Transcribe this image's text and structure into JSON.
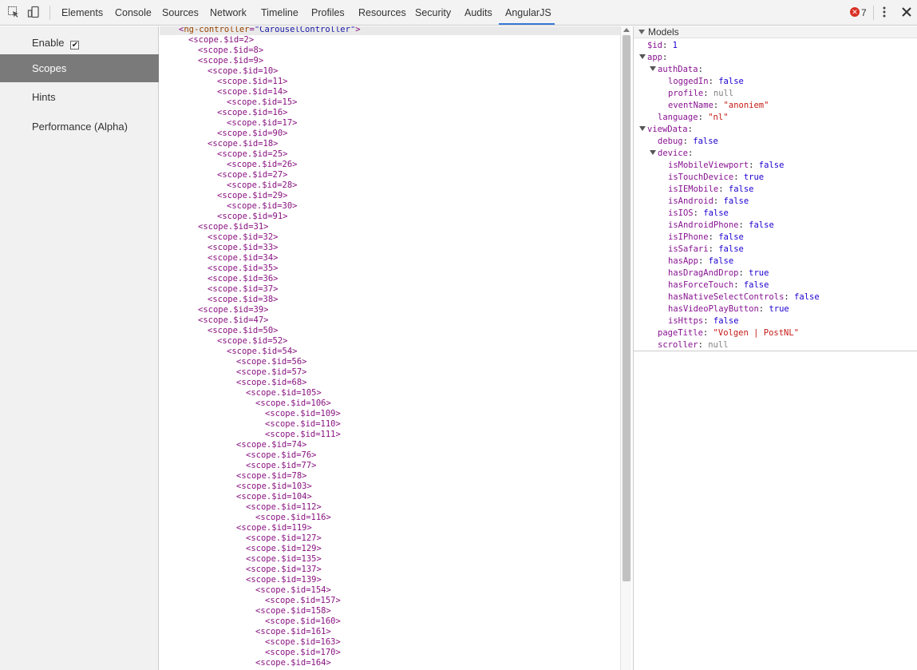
{
  "toolbar": {
    "tabs": [
      "Elements",
      "Console",
      "Sources",
      "Network",
      "Timeline",
      "Profiles",
      "Resources",
      "Security",
      "Audits",
      "AngularJS"
    ],
    "active_tab": "AngularJS",
    "error_count": "7",
    "accent": "#3879d9"
  },
  "sidebar": {
    "enable_label": "Enable",
    "enable_checked": "✔",
    "items": [
      "Scopes",
      "Hints",
      "Performance (Alpha)"
    ],
    "selected": "Scopes"
  },
  "tree": {
    "root_tag_open": "<",
    "root_attr_name": "ng-controller",
    "root_attr_eq": "=",
    "root_attr_value": "\"CarouselController\"",
    "root_tag_close": ">",
    "rows": [
      {
        "level": 1,
        "text": "<scope.$id=2>"
      },
      {
        "level": 2,
        "text": "<scope.$id=8>"
      },
      {
        "level": 2,
        "text": "<scope.$id=9>"
      },
      {
        "level": 3,
        "text": "<scope.$id=10>"
      },
      {
        "level": 4,
        "text": "<scope.$id=11>"
      },
      {
        "level": 4,
        "text": "<scope.$id=14>"
      },
      {
        "level": 5,
        "text": "<scope.$id=15>"
      },
      {
        "level": 4,
        "text": "<scope.$id=16>"
      },
      {
        "level": 5,
        "text": "<scope.$id=17>"
      },
      {
        "level": 4,
        "text": "<scope.$id=90>"
      },
      {
        "level": 3,
        "text": "<scope.$id=18>"
      },
      {
        "level": 4,
        "text": "<scope.$id=25>"
      },
      {
        "level": 5,
        "text": "<scope.$id=26>"
      },
      {
        "level": 4,
        "text": "<scope.$id=27>"
      },
      {
        "level": 5,
        "text": "<scope.$id=28>"
      },
      {
        "level": 4,
        "text": "<scope.$id=29>"
      },
      {
        "level": 5,
        "text": "<scope.$id=30>"
      },
      {
        "level": 4,
        "text": "<scope.$id=91>"
      },
      {
        "level": 2,
        "text": "<scope.$id=31>"
      },
      {
        "level": 3,
        "text": "<scope.$id=32>"
      },
      {
        "level": 3,
        "text": "<scope.$id=33>"
      },
      {
        "level": 3,
        "text": "<scope.$id=34>"
      },
      {
        "level": 3,
        "text": "<scope.$id=35>"
      },
      {
        "level": 3,
        "text": "<scope.$id=36>"
      },
      {
        "level": 3,
        "text": "<scope.$id=37>"
      },
      {
        "level": 3,
        "text": "<scope.$id=38>"
      },
      {
        "level": 2,
        "text": "<scope.$id=39>"
      },
      {
        "level": 2,
        "text": "<scope.$id=47>"
      },
      {
        "level": 3,
        "text": "<scope.$id=50>"
      },
      {
        "level": 4,
        "text": "<scope.$id=52>"
      },
      {
        "level": 5,
        "text": "<scope.$id=54>"
      },
      {
        "level": 6,
        "text": "<scope.$id=56>"
      },
      {
        "level": 6,
        "text": "<scope.$id=57>"
      },
      {
        "level": 6,
        "text": "<scope.$id=68>"
      },
      {
        "level": 7,
        "text": "<scope.$id=105>"
      },
      {
        "level": 8,
        "text": "<scope.$id=106>"
      },
      {
        "level": 9,
        "text": "<scope.$id=109>"
      },
      {
        "level": 9,
        "text": "<scope.$id=110>"
      },
      {
        "level": 9,
        "text": "<scope.$id=111>"
      },
      {
        "level": 6,
        "text": "<scope.$id=74>"
      },
      {
        "level": 7,
        "text": "<scope.$id=76>"
      },
      {
        "level": 7,
        "text": "<scope.$id=77>"
      },
      {
        "level": 6,
        "text": "<scope.$id=78>"
      },
      {
        "level": 6,
        "text": "<scope.$id=103>"
      },
      {
        "level": 6,
        "text": "<scope.$id=104>"
      },
      {
        "level": 7,
        "text": "<scope.$id=112>"
      },
      {
        "level": 8,
        "text": "<scope.$id=116>"
      },
      {
        "level": 6,
        "text": "<scope.$id=119>"
      },
      {
        "level": 7,
        "text": "<scope.$id=127>"
      },
      {
        "level": 7,
        "text": "<scope.$id=129>"
      },
      {
        "level": 7,
        "text": "<scope.$id=135>"
      },
      {
        "level": 7,
        "text": "<scope.$id=137>"
      },
      {
        "level": 7,
        "text": "<scope.$id=139>"
      },
      {
        "level": 8,
        "text": "<scope.$id=154>"
      },
      {
        "level": 9,
        "text": "<scope.$id=157>"
      },
      {
        "level": 8,
        "text": "<scope.$id=158>"
      },
      {
        "level": 9,
        "text": "<scope.$id=160>"
      },
      {
        "level": 8,
        "text": "<scope.$id=161>"
      },
      {
        "level": 9,
        "text": "<scope.$id=163>"
      },
      {
        "level": 9,
        "text": "<scope.$id=170>"
      },
      {
        "level": 8,
        "text": "<scope.$id=164>"
      }
    ]
  },
  "models": {
    "title": "Models",
    "rows": [
      {
        "indent": 0,
        "expander": false,
        "key": "$id",
        "value": "1",
        "kind": "num"
      },
      {
        "indent": 0,
        "expander": true,
        "key": "app",
        "value": "",
        "kind": "none"
      },
      {
        "indent": 1,
        "expander": true,
        "key": "authData",
        "value": "",
        "kind": "none"
      },
      {
        "indent": 2,
        "expander": false,
        "key": "loggedIn",
        "value": "false",
        "kind": "bool"
      },
      {
        "indent": 2,
        "expander": false,
        "key": "profile",
        "value": "null",
        "kind": "null"
      },
      {
        "indent": 2,
        "expander": false,
        "key": "eventName",
        "value": "\"anoniem\"",
        "kind": "str"
      },
      {
        "indent": 1,
        "expander": false,
        "key": "language",
        "value": "\"nl\"",
        "kind": "str"
      },
      {
        "indent": 0,
        "expander": true,
        "key": "viewData",
        "value": "",
        "kind": "none"
      },
      {
        "indent": 1,
        "expander": false,
        "key": "debug",
        "value": "false",
        "kind": "bool"
      },
      {
        "indent": 1,
        "expander": true,
        "key": "device",
        "value": "",
        "kind": "none"
      },
      {
        "indent": 2,
        "expander": false,
        "key": "isMobileViewport",
        "value": "false",
        "kind": "bool"
      },
      {
        "indent": 2,
        "expander": false,
        "key": "isTouchDevice",
        "value": "true",
        "kind": "bool"
      },
      {
        "indent": 2,
        "expander": false,
        "key": "isIEMobile",
        "value": "false",
        "kind": "bool"
      },
      {
        "indent": 2,
        "expander": false,
        "key": "isAndroid",
        "value": "false",
        "kind": "bool"
      },
      {
        "indent": 2,
        "expander": false,
        "key": "isIOS",
        "value": "false",
        "kind": "bool"
      },
      {
        "indent": 2,
        "expander": false,
        "key": "isAndroidPhone",
        "value": "false",
        "kind": "bool"
      },
      {
        "indent": 2,
        "expander": false,
        "key": "isIPhone",
        "value": "false",
        "kind": "bool"
      },
      {
        "indent": 2,
        "expander": false,
        "key": "isSafari",
        "value": "false",
        "kind": "bool"
      },
      {
        "indent": 2,
        "expander": false,
        "key": "hasApp",
        "value": "false",
        "kind": "bool"
      },
      {
        "indent": 2,
        "expander": false,
        "key": "hasDragAndDrop",
        "value": "true",
        "kind": "bool"
      },
      {
        "indent": 2,
        "expander": false,
        "key": "hasForceTouch",
        "value": "false",
        "kind": "bool"
      },
      {
        "indent": 2,
        "expander": false,
        "key": "hasNativeSelectControls",
        "value": "false",
        "kind": "bool"
      },
      {
        "indent": 2,
        "expander": false,
        "key": "hasVideoPlayButton",
        "value": "true",
        "kind": "bool"
      },
      {
        "indent": 2,
        "expander": false,
        "key": "isHttps",
        "value": "false",
        "kind": "bool"
      },
      {
        "indent": 1,
        "expander": false,
        "key": "pageTitle",
        "value": "\"Volgen | PostNL\"",
        "kind": "str"
      },
      {
        "indent": 1,
        "expander": false,
        "key": "scroller",
        "value": "null",
        "kind": "null"
      }
    ]
  }
}
